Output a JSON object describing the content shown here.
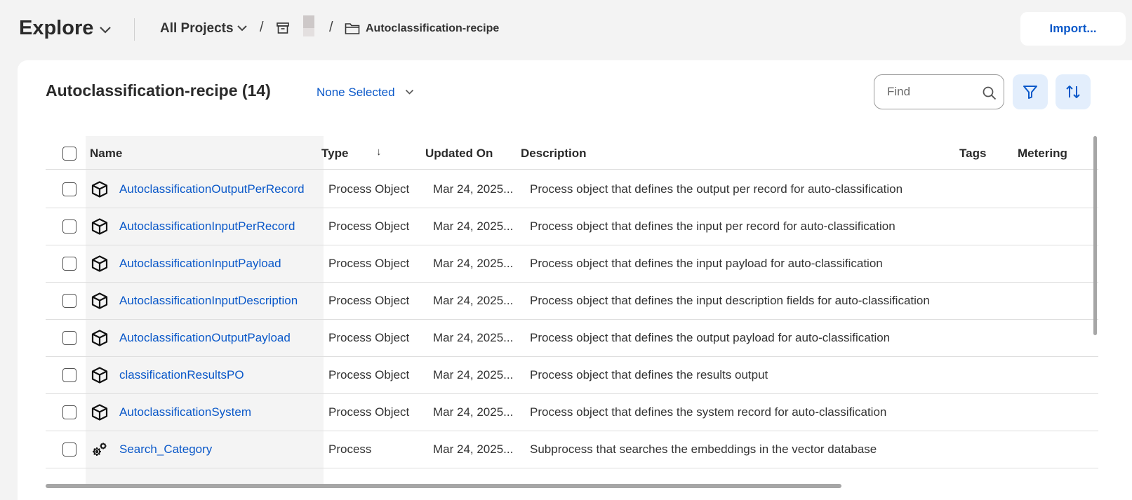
{
  "header": {
    "title": "Explore",
    "all_projects": "All Projects",
    "separator": "/",
    "current_folder": "Autoclassification-recipe",
    "import_label": "Import..."
  },
  "toolbar": {
    "title": "Autoclassification-recipe (14)",
    "none_selected": "None Selected",
    "find_placeholder": "Find"
  },
  "table": {
    "columns": {
      "name": "Name",
      "type": "Type",
      "type_sort": "↓",
      "updated": "Updated On",
      "description": "Description",
      "tags": "Tags",
      "metering": "Metering"
    },
    "rows": [
      {
        "icon": "cube-icon",
        "name": "AutoclassificationOutputPerRecord",
        "type": "Process Object",
        "updated": "Mar 24, 2025...",
        "description": "Process object that defines the output per record for auto-classification"
      },
      {
        "icon": "cube-icon",
        "name": "AutoclassificationInputPerRecord",
        "type": "Process Object",
        "updated": "Mar 24, 2025...",
        "description": "Process object that defines the input per record for auto-classification"
      },
      {
        "icon": "cube-icon",
        "name": "AutoclassificationInputPayload",
        "type": "Process Object",
        "updated": "Mar 24, 2025...",
        "description": "Process object that defines the input payload for auto-classification"
      },
      {
        "icon": "cube-icon",
        "name": "AutoclassificationInputDescription",
        "type": "Process Object",
        "updated": "Mar 24, 2025...",
        "description": "Process object that defines the input description fields for auto-classification"
      },
      {
        "icon": "cube-icon",
        "name": "AutoclassificationOutputPayload",
        "type": "Process Object",
        "updated": "Mar 24, 2025...",
        "description": "Process object that defines the output payload for auto-classification"
      },
      {
        "icon": "cube-icon",
        "name": "classificationResultsPO",
        "type": "Process Object",
        "updated": "Mar 24, 2025...",
        "description": "Process object that defines the results output"
      },
      {
        "icon": "cube-icon",
        "name": "AutoclassificationSystem",
        "type": "Process Object",
        "updated": "Mar 24, 2025...",
        "description": "Process object that defines the system record for auto-classification"
      },
      {
        "icon": "gears-icon",
        "name": "Search_Category",
        "type": "Process",
        "updated": "Mar 24, 2025...",
        "description": "Subprocess that searches the embeddings in the vector database"
      }
    ]
  },
  "colors": {
    "link": "#0a58c9",
    "background": "#f3f3f3",
    "icon_button_bg": "#e3eefc"
  }
}
